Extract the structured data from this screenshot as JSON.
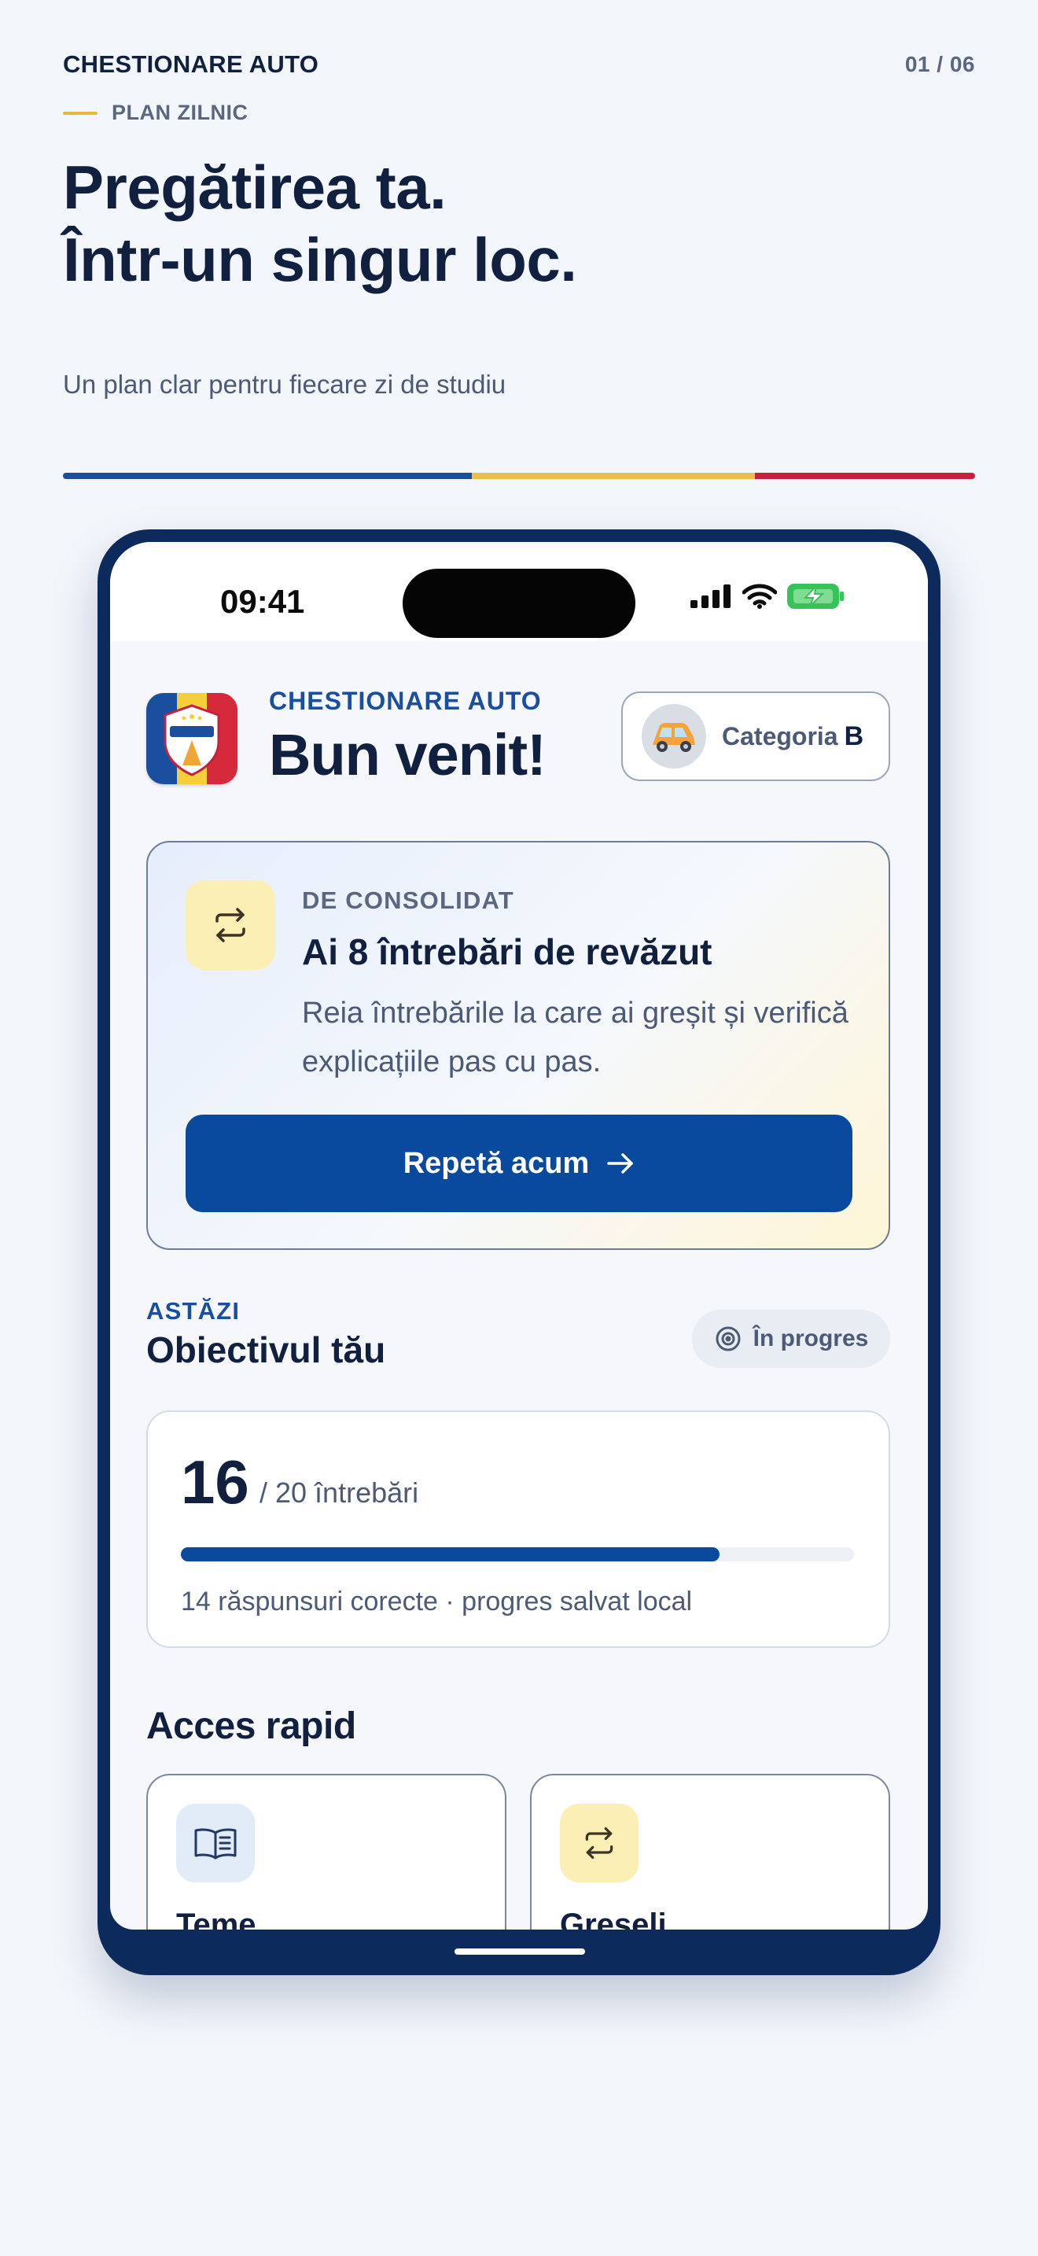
{
  "header": {
    "brand": "CHESTIONARE AUTO",
    "page_count": "01 / 06",
    "eyebrow": "PLAN ZILNIC",
    "headline_line1": "Pregătirea ta.",
    "headline_line2": "Într-un singur loc.",
    "subtitle": "Un plan clar pentru fiecare zi de studiu"
  },
  "tricolor": [
    "#1d4f99",
    "#e9c04a",
    "#c8203c"
  ],
  "status_bar": {
    "time": "09:41",
    "icons": [
      "signal-icon",
      "wifi-icon",
      "battery-charging-icon"
    ]
  },
  "app": {
    "kicker": "CHESTIONARE AUTO",
    "title": "Bun venit!",
    "category_label": "Categoria",
    "category_value": "B"
  },
  "review": {
    "kicker": "DE CONSOLIDAT",
    "title": "Ai 8 întrebări de revăzut",
    "description": "Reia întrebările la care ai greșit și verifică explicațiile pas cu pas.",
    "button_label": "Repetă acum",
    "icon": "repeat-icon"
  },
  "goal": {
    "kicker": "ASTĂZI",
    "heading": "Obiectivul tău",
    "status": "În progres",
    "count": "16",
    "total": "/ 20 întrebări",
    "progress": 0.8,
    "note": "14 răspunsuri corecte · progres salvat local"
  },
  "quick_access": {
    "heading": "Acces rapid",
    "tiles": [
      {
        "label": "Teme",
        "icon": "book-icon"
      },
      {
        "label": "Greseli",
        "icon": "repeat-icon"
      }
    ]
  },
  "colors": {
    "accent": "#0a4a9e",
    "brand_blue": "#1a4fa0",
    "frame": "#0d2a5c",
    "yellow_soft": "#fcefb6"
  }
}
